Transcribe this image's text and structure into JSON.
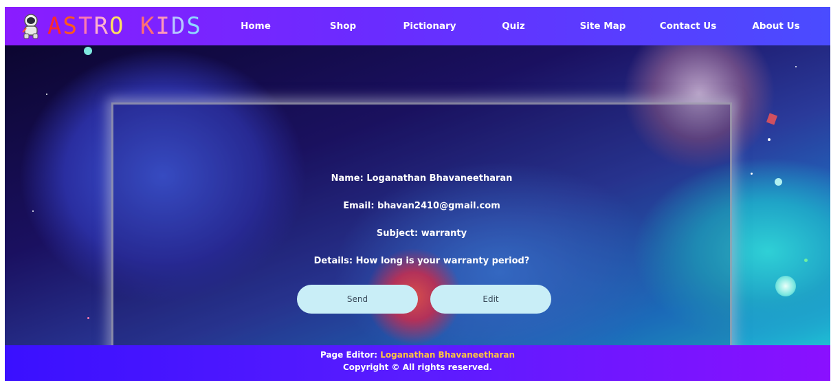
{
  "logo": {
    "letters": [
      {
        "ch": "A",
        "color": "#ff2a2a"
      },
      {
        "ch": "S",
        "color": "#ff5a1a"
      },
      {
        "ch": "T",
        "color": "#ff7ab0"
      },
      {
        "ch": "R",
        "color": "#ffb0d0"
      },
      {
        "ch": "O",
        "color": "#ffe060"
      },
      {
        "ch": " ",
        "color": "#ffffff"
      },
      {
        "ch": "K",
        "color": "#ff7070"
      },
      {
        "ch": "I",
        "color": "#ff9ab8"
      },
      {
        "ch": "D",
        "color": "#b8c8ff"
      },
      {
        "ch": "S",
        "color": "#90d8ff"
      }
    ],
    "icon": "astronaut-icon"
  },
  "nav": {
    "items": [
      "Home",
      "Shop",
      "Pictionary",
      "Quiz",
      "Site Map",
      "Contact Us",
      "About Us"
    ]
  },
  "form_preview": {
    "name": "Name: Loganathan Bhavaneetharan",
    "email": "Email: bhavan2410@gmail.com",
    "subject": "Subject: warranty",
    "details": "Details: How long is your warranty period?"
  },
  "buttons": {
    "send": "Send",
    "edit": "Edit"
  },
  "footer": {
    "editor_label": "Page Editor: ",
    "editor_name": "Loganathan Bhavaneetharan",
    "copyright": "Copyright © All rights reserved."
  },
  "colors": {
    "nav_gradient_start": "#8a1cff",
    "nav_gradient_end": "#4a4cff",
    "button_bg": "#c9eef7",
    "editor_name": "#ffc640"
  }
}
